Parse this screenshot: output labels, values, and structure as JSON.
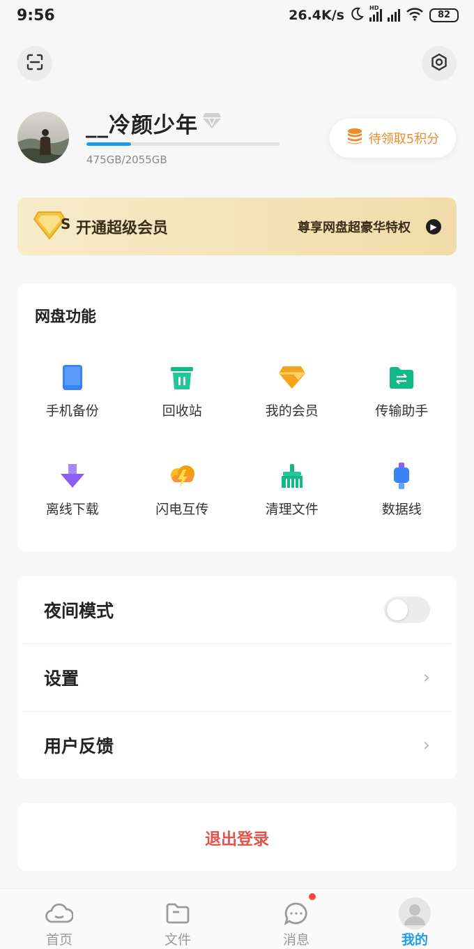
{
  "status_bar": {
    "time": "9:56",
    "network_speed": "26.4K/s",
    "hd_label": "HD",
    "battery": "82"
  },
  "header": {
    "scan_icon": "scan-icon",
    "settings_icon": "hexagon-settings-icon"
  },
  "profile": {
    "username": "__冷颜少年",
    "storage_text": "475GB/2055GB",
    "storage_used_fraction": 0.23,
    "points_label": "待领取5积分"
  },
  "vip_banner": {
    "badge_letter": "S",
    "title": "开通超级会员",
    "subtitle": "尊享网盘超豪华特权"
  },
  "features": {
    "title": "网盘功能",
    "items": [
      {
        "label": "手机备份",
        "icon": "phone-backup-icon",
        "color": "#3b82f6"
      },
      {
        "label": "回收站",
        "icon": "trash-icon",
        "color": "#12b886"
      },
      {
        "label": "我的会员",
        "icon": "diamond-icon",
        "color": "#f7a21b"
      },
      {
        "label": "传输助手",
        "icon": "transfer-folder-icon",
        "color": "#12b886"
      },
      {
        "label": "离线下载",
        "icon": "download-arrow-icon",
        "color": "#8b5cf6"
      },
      {
        "label": "闪电互传",
        "icon": "lightning-cloud-icon",
        "color": "#f59e0b"
      },
      {
        "label": "清理文件",
        "icon": "broom-icon",
        "color": "#12b886"
      },
      {
        "label": "数据线",
        "icon": "cable-icon",
        "color": "#3b82f6"
      }
    ]
  },
  "settings": {
    "night_mode": "夜间模式",
    "night_mode_on": false,
    "settings": "设置",
    "feedback": "用户反馈"
  },
  "logout": {
    "label": "退出登录"
  },
  "tabbar": {
    "tabs": [
      {
        "label": "首页",
        "icon": "cloud-icon"
      },
      {
        "label": "文件",
        "icon": "folder-icon"
      },
      {
        "label": "消息",
        "icon": "chat-bubble-icon"
      },
      {
        "label": "我的",
        "icon": "user-avatar-icon"
      }
    ],
    "active_color": "#1a9ee8"
  }
}
